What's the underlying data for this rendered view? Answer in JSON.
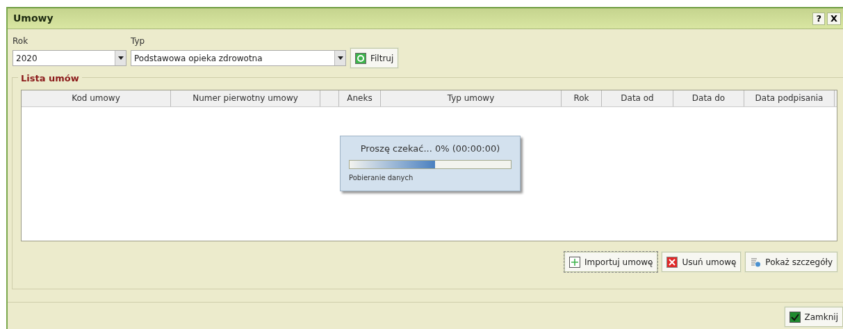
{
  "window": {
    "title": "Umowy",
    "help_button": "?",
    "close_button": "X"
  },
  "filters": {
    "year": {
      "label": "Rok",
      "value": "2020"
    },
    "type": {
      "label": "Typ",
      "value": "Podstawowa opieka zdrowotna"
    },
    "filter_button": "Filtruj"
  },
  "contracts": {
    "legend": "Lista umów",
    "columns": [
      "Kod umowy",
      "Numer pierwotny umowy",
      "Aneks",
      "Typ umowy",
      "Rok",
      "Data od",
      "Data do",
      "Data podpisania"
    ]
  },
  "progress": {
    "message": "Proszę czekać... 0% (00:00:00)",
    "level": 0.53,
    "caption": "Pobieranie danych"
  },
  "actions": [
    {
      "label": "Importuj umowę",
      "kind": "add"
    },
    {
      "label": "Usuń umowę",
      "kind": "delete"
    },
    {
      "label": "Pokaż szczegóły",
      "kind": "details"
    }
  ],
  "close_button": "Zamknij"
}
